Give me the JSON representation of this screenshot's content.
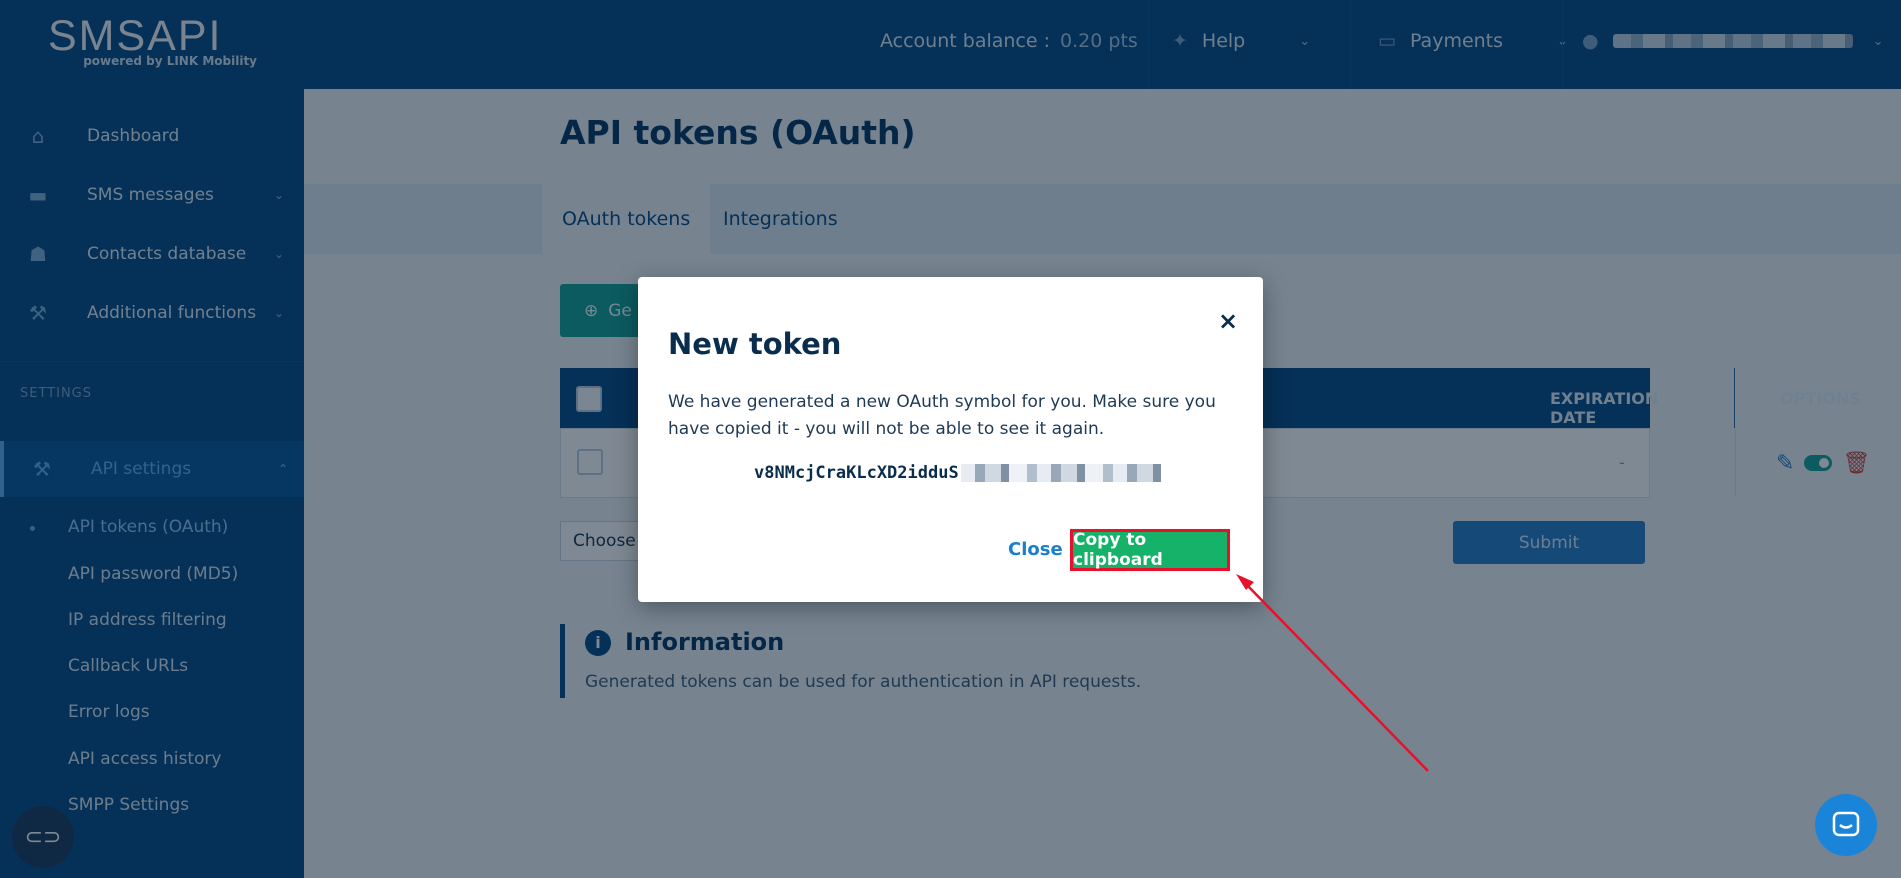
{
  "header": {
    "logo_text": "SMSAPI",
    "logo_sub": "powered by LINK Mobility",
    "balance_label": "Account balance :",
    "balance_value": "0.20 pts",
    "help_label": "Help",
    "payments_label": "Payments"
  },
  "sidebar": {
    "items": [
      {
        "label": "Dashboard",
        "icon": "home-icon"
      },
      {
        "label": "SMS messages",
        "icon": "chat-icon"
      },
      {
        "label": "Contacts database",
        "icon": "contacts-icon"
      },
      {
        "label": "Additional functions",
        "icon": "wrench-icon"
      }
    ],
    "section_label": "SETTINGS",
    "active_item": {
      "label": "API settings",
      "icon": "wrench-icon"
    },
    "subitems": [
      "API tokens (OAuth)",
      "API password (MD5)",
      "IP address filtering",
      "Callback URLs",
      "Error logs",
      "API access history",
      "SMPP Settings"
    ]
  },
  "main": {
    "title": "API tokens (OAuth)",
    "tabs": [
      "OAuth tokens",
      "Integrations"
    ],
    "generate_label": "Ge",
    "table": {
      "col_expiration": "EXPIRATION DATE",
      "col_options": "OPTIONS",
      "row_expiration": "-"
    },
    "choose_label": "Choose",
    "submit_label": "Submit",
    "info_title": "Information",
    "info_text": "Generated tokens can be used for authentication in API requests."
  },
  "modal": {
    "title": "New token",
    "close_icon": "×",
    "message": "We have generated a new OAuth symbol for you. Make sure you have copied it - you will not be able to see it again.",
    "token_visible": "v8NMcjCraKLcXD2idduS",
    "close_label": "Close",
    "copy_label": "Copy to clipboard"
  },
  "colors": {
    "brand": "#0a4d87",
    "copy_button": "#17b26a",
    "highlight": "#e8102a",
    "link": "#1a7fc9"
  }
}
